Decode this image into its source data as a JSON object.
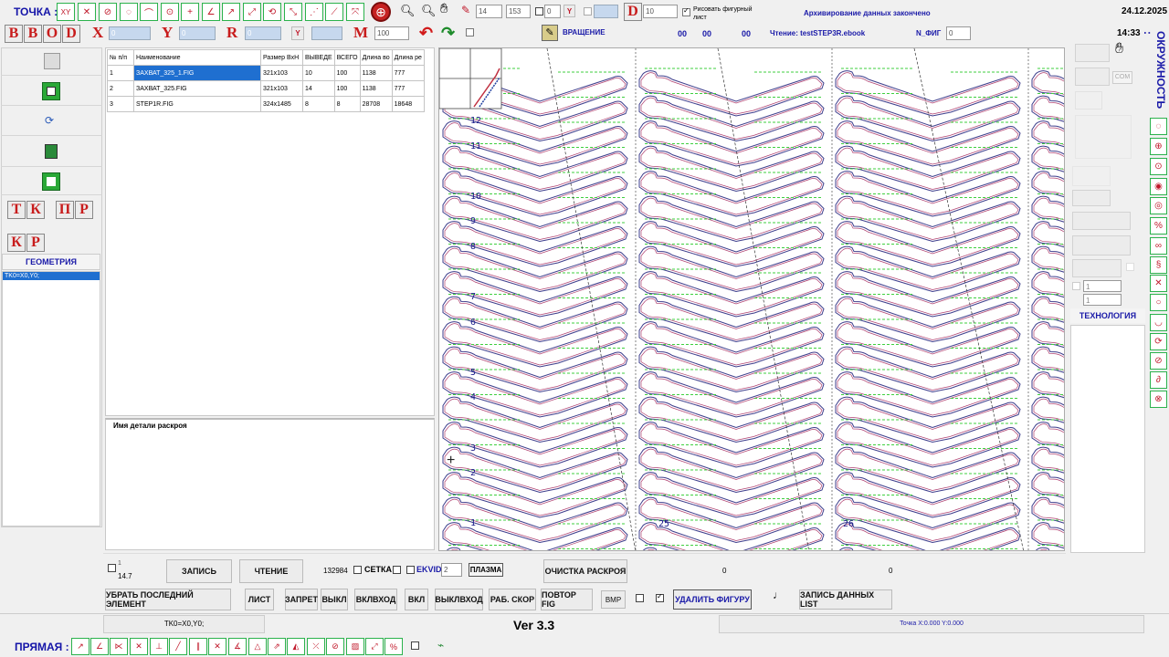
{
  "top": {
    "point_label": "ТОЧКА :",
    "date": "24.12.2025",
    "time": "14:33",
    "input_14": "14",
    "input_153": "153",
    "input_0": "0",
    "input_10": "10",
    "draw_sheet_label": "Рисовать фигурный лист",
    "archive_status": "Архивирование данных закончено",
    "letters": [
      "B",
      "B",
      "O",
      "D"
    ],
    "x_label": "X",
    "x_value": "0",
    "y_label": "Y",
    "y_value": "0",
    "r_label": "R",
    "r_value": "0",
    "m_label": "M",
    "m_value": "100",
    "d_label": "D",
    "rotation_label": "ВРАЩЕНИЕ",
    "counters": [
      "00",
      "00",
      "00"
    ],
    "reading_label": "Чтение: testSTEP3R.ebook",
    "nfig_label": "N_ФИГ",
    "nfig_value": "0"
  },
  "left": {
    "tk": [
      "Т",
      "К"
    ],
    "pr": [
      "П",
      "Р"
    ],
    "kr": [
      "К",
      "Р"
    ],
    "geometry_label": "ГЕОМЕТРИЯ",
    "geometry_item": "TK0=X0,Y0;"
  },
  "table": {
    "headers": [
      "№ п/п",
      "Наименование",
      "Размер ВхН",
      "ВЫВЕДЕ",
      "ВСЕГО",
      "Длина во",
      "Длина ре"
    ],
    "rows": [
      [
        "1",
        "ЗАХВАТ_325_1.FIG",
        "321x103",
        "10",
        "100",
        "1138",
        "777"
      ],
      [
        "2",
        "ЗАХВАТ_325.FIG",
        "321x103",
        "14",
        "100",
        "1138",
        "777"
      ],
      [
        "3",
        "STEP1R.FIG",
        "324x1485",
        "8",
        "8",
        "28708",
        "18648"
      ]
    ],
    "detail_label": "Имя детали раскроя"
  },
  "canvas": {
    "row_numbers": [
      "12",
      "11",
      "10",
      "9",
      "8",
      "7",
      "6",
      "5",
      "4",
      "3",
      "2",
      "1"
    ],
    "col_numbers": [
      "25",
      "26"
    ]
  },
  "right": {
    "circle_label": "ОКРУЖНОСТЬ :",
    "com_label": "COM",
    "val1": "1",
    "val2": "1",
    "tech_label": "ТЕХНОЛОГИЯ"
  },
  "bottom": {
    "small_top": "1",
    "small_val": "14.7",
    "record": "ЗАПИСЬ",
    "reading": "ЧТЕНИЕ",
    "count": "132984",
    "grid": "СЕТКА",
    "ekvid": "EKVID",
    "ekvid_value": "2",
    "plasma": "ПЛАЗМА",
    "clear": "ОЧИСТКА РАСКРОЯ",
    "zero1": "0",
    "zero2": "0",
    "remove_last": "УБРАТЬ ПОСЛЕДНИЙ ЭЛЕМЕНТ",
    "list": "ЛИСТ",
    "ban": "ЗАПРЕТ",
    "off": "ВЫКЛ",
    "onin": "ВКЛВХОД",
    "on": "ВКЛ",
    "offout": "ВЫКЛВХОД",
    "work_speed": "РАБ. СКОР",
    "repeat_fig": "ПОВТОР FIG",
    "bmp": "BMP",
    "delete_fig": "УДАЛИТЬ ФИГУРУ",
    "write_list": "ЗАПИСЬ ДАННЫХ LIST",
    "status_left": "TK0=X0,Y0;",
    "version": "Ver 3.3",
    "point_status": "Точка X:0.000 Y:0.000",
    "line_label": "ПРЯМАЯ :"
  }
}
